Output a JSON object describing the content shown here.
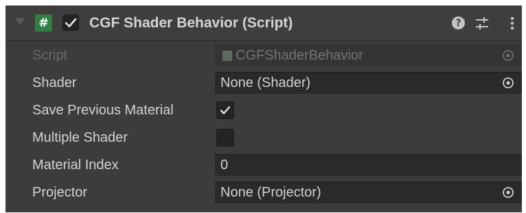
{
  "component": {
    "title": "CGF Shader Behavior (Script)",
    "enabled": true,
    "icon_glyph": "#",
    "icons": {
      "foldout": "foldout-triangle-icon",
      "script": "script-icon",
      "help": "help-icon",
      "presets": "presets-icon",
      "more": "more-options-icon"
    },
    "help_glyph": "?"
  },
  "fields": {
    "script": {
      "label": "Script",
      "value": "CGFShaderBehavior",
      "disabled": true
    },
    "shader": {
      "label": "Shader",
      "value": "None (Shader)"
    },
    "save_previous_material": {
      "label": "Save Previous Material",
      "checked": true
    },
    "multiple_shader": {
      "label": "Multiple Shader",
      "checked": false
    },
    "material_index": {
      "label": "Material Index",
      "value": "0"
    },
    "projector": {
      "label": "Projector",
      "value": "None (Projector)"
    }
  },
  "colors": {
    "panel_bg": "#3c3c3c",
    "field_bg": "#2a2a2a",
    "text": "#d2d2d2",
    "disabled_text": "#6a6a6a",
    "script_icon_green": "#2f7f43"
  }
}
